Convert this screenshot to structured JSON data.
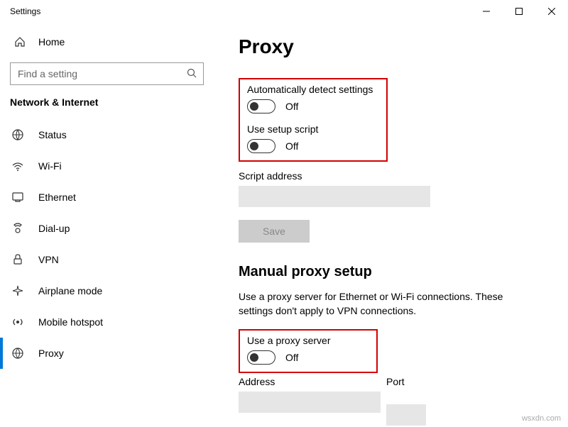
{
  "window": {
    "title": "Settings"
  },
  "sidebar": {
    "home_label": "Home",
    "search_placeholder": "Find a setting",
    "category": "Network & Internet",
    "items": [
      {
        "label": "Status"
      },
      {
        "label": "Wi-Fi"
      },
      {
        "label": "Ethernet"
      },
      {
        "label": "Dial-up"
      },
      {
        "label": "VPN"
      },
      {
        "label": "Airplane mode"
      },
      {
        "label": "Mobile hotspot"
      },
      {
        "label": "Proxy"
      }
    ]
  },
  "page": {
    "title": "Proxy",
    "auto_detect": {
      "label": "Automatically detect settings",
      "state": "Off"
    },
    "use_script": {
      "label": "Use setup script",
      "state": "Off"
    },
    "script_address_label": "Script address",
    "script_address_value": "",
    "save_label": "Save",
    "manual_header": "Manual proxy setup",
    "manual_desc": "Use a proxy server for Ethernet or Wi-Fi connections. These settings don't apply to VPN connections.",
    "use_proxy": {
      "label": "Use a proxy server",
      "state": "Off"
    },
    "address_label": "Address",
    "port_label": "Port"
  },
  "watermark": "wsxdn.com"
}
